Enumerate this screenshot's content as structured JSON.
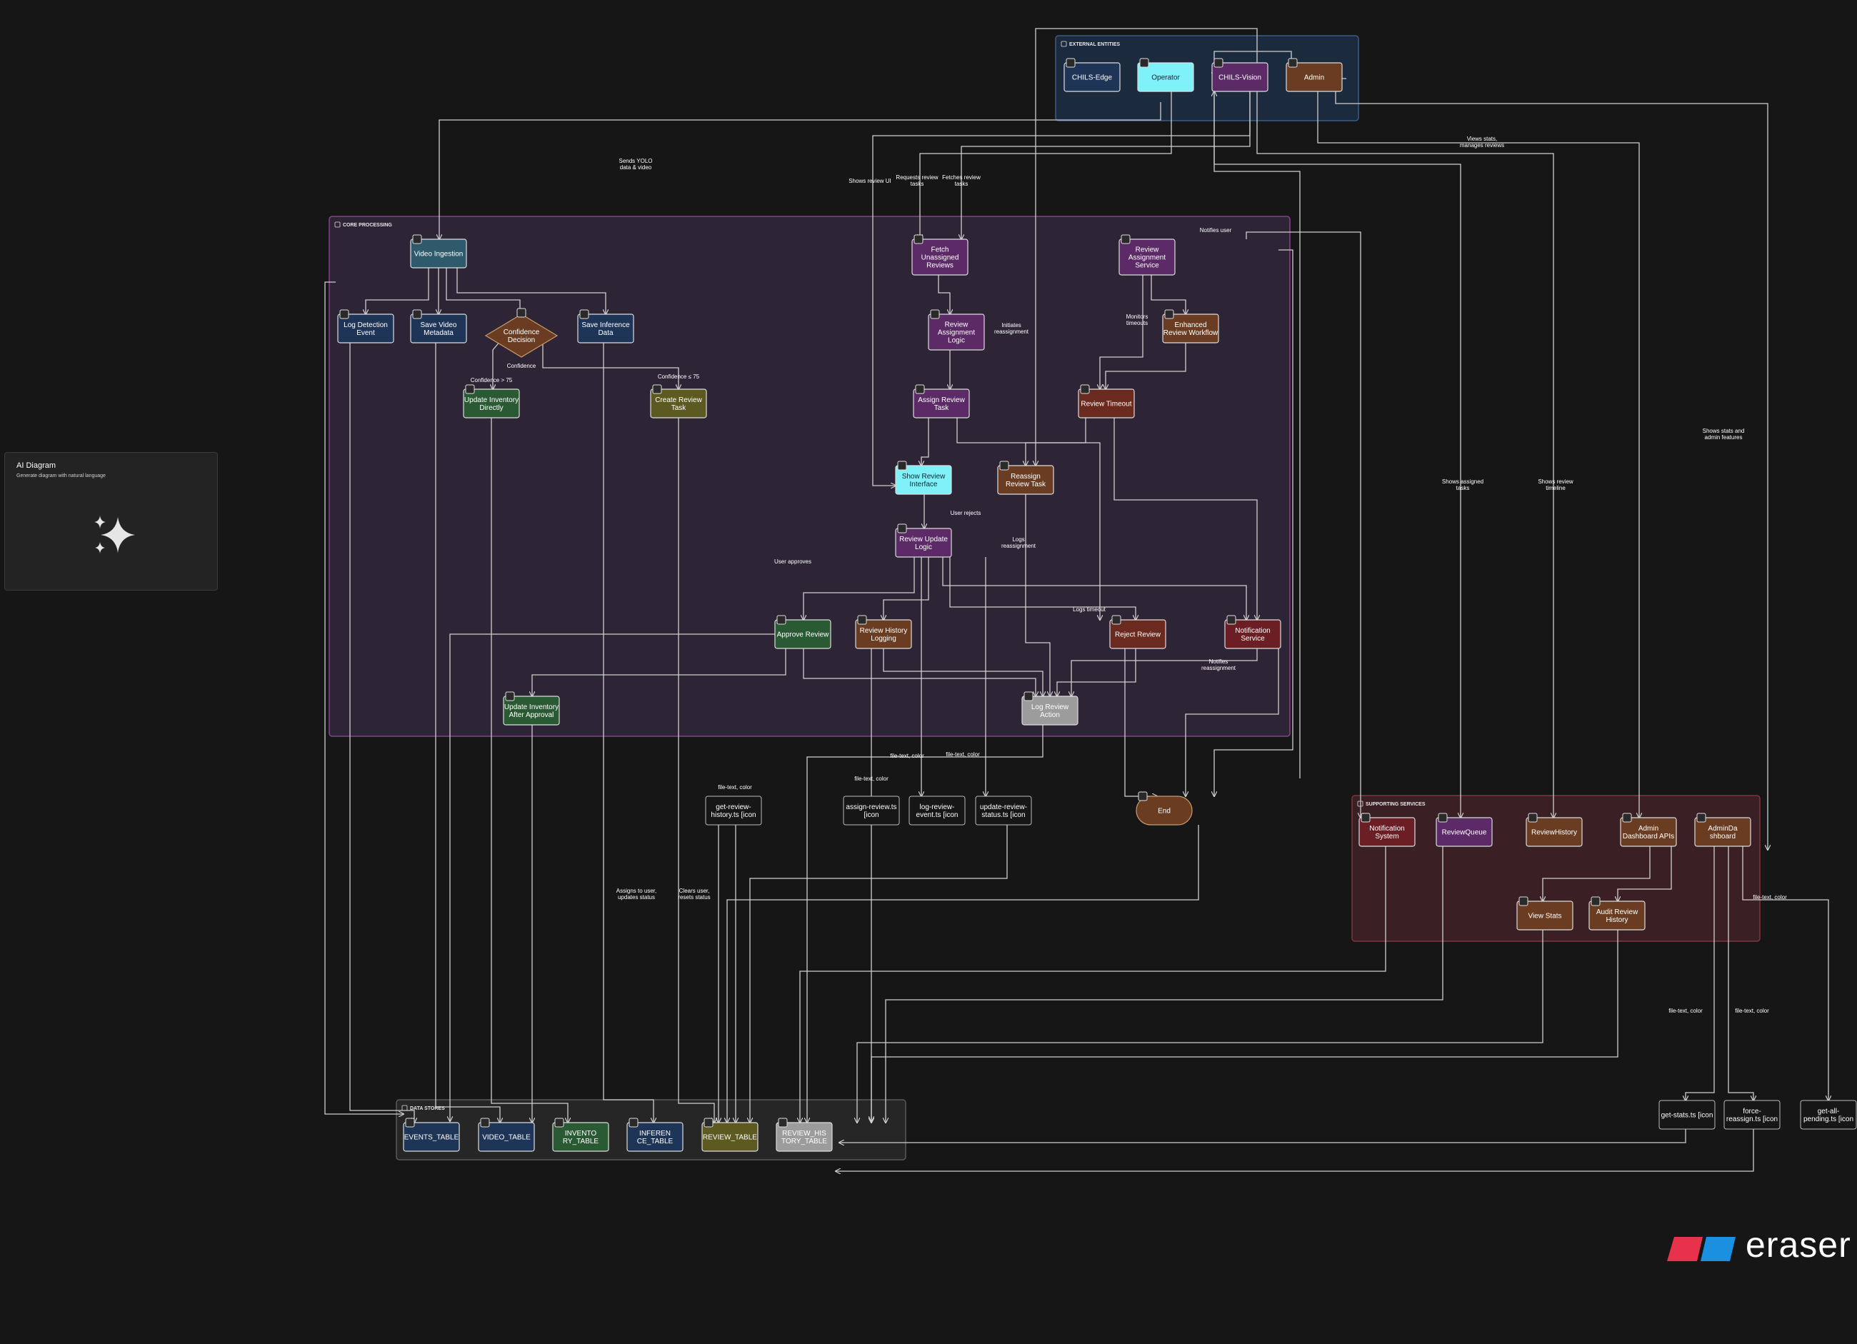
{
  "ai_panel": {
    "title": "AI Diagram",
    "subtitle": "Generate diagram with natural language"
  },
  "brand": {
    "name": "eraser"
  },
  "colors": {
    "background": "#161616",
    "edge": "#cfcfcf",
    "brand_red": "#e8314a",
    "brand_blue": "#1b8fe0"
  },
  "groups": [
    {
      "id": "external",
      "label": "EXTERNAL ENTITIES",
      "icon": "users-icon",
      "fill": "#1c2a3e",
      "stroke": "#3c5b86"
    },
    {
      "id": "core",
      "label": "CORE PROCESSING",
      "icon": "rocket-icon",
      "fill": "#2d2435",
      "stroke": "#8a3f8f"
    },
    {
      "id": "supporting",
      "label": "SUPPORTING SERVICES",
      "icon": "gear-icon",
      "fill": "#3a1f24",
      "stroke": "#7d3541"
    },
    {
      "id": "datastores",
      "label": "DATA STORES",
      "icon": "database-icon",
      "fill": "#262626",
      "stroke": "#585858"
    }
  ],
  "nodes": [
    {
      "id": "chils_edge",
      "label": [
        "CHILS-Edge"
      ],
      "icon": "camera-icon",
      "fill": "#1f3557",
      "text": "#ffffff"
    },
    {
      "id": "operator",
      "label": [
        "Operator"
      ],
      "icon": "user-icon",
      "fill": "#7ef2f8",
      "text": "#123"
    },
    {
      "id": "chils_vision",
      "label": [
        "CHILS-Vision"
      ],
      "icon": "eye-icon",
      "fill": "#5b2a67",
      "text": "#ffffff"
    },
    {
      "id": "admin",
      "label": [
        "Admin"
      ],
      "icon": "shield-icon",
      "fill": "#6a3d22",
      "text": "#ffffff"
    },
    {
      "id": "video_ingestion",
      "label": [
        "Video Ingestion"
      ],
      "icon": "video-icon",
      "fill": "#2f5a6b",
      "text": "#ffffff"
    },
    {
      "id": "log_detection",
      "label": [
        "Log Detection",
        "Event"
      ],
      "icon": "activity-icon",
      "fill": "#1f3557",
      "text": "#ffffff"
    },
    {
      "id": "save_video_meta",
      "label": [
        "Save Video",
        "Metadata"
      ],
      "icon": "film-icon",
      "fill": "#1f3557",
      "text": "#ffffff"
    },
    {
      "id": "confidence",
      "label": [
        "Confidence",
        "Decision"
      ],
      "icon": "gauge-icon",
      "fill": "#6a3d22",
      "text": "#ffffff"
    },
    {
      "id": "save_inference",
      "label": [
        "Save Inference",
        "Data"
      ],
      "icon": "cpu-icon",
      "fill": "#1f3557",
      "text": "#ffffff"
    },
    {
      "id": "update_inv_direct",
      "label": [
        "Update Inventory",
        "Directly"
      ],
      "icon": "box-icon",
      "fill": "#2a5a33",
      "text": "#ffffff"
    },
    {
      "id": "create_review",
      "label": [
        "Create Review",
        "Task"
      ],
      "icon": "plus-icon",
      "fill": "#5c5a20",
      "text": "#ffffff"
    },
    {
      "id": "fetch_unassigned",
      "label": [
        "Fetch",
        "Unassigned",
        "Reviews"
      ],
      "icon": "search-icon",
      "fill": "#5b2a67",
      "text": "#ffffff"
    },
    {
      "id": "review_assign_service",
      "label": [
        "Review",
        "Assignment",
        "Service"
      ],
      "icon": "users-icon",
      "fill": "#5b2a67",
      "text": "#ffffff"
    },
    {
      "id": "review_assign_logic",
      "label": [
        "Review",
        "Assignment",
        "Logic"
      ],
      "icon": "code-icon",
      "fill": "#5b2a67",
      "text": "#ffffff"
    },
    {
      "id": "enhanced_workflow",
      "label": [
        "Enhanced",
        "Review Workflow"
      ],
      "icon": "refresh-icon",
      "fill": "#6a3d22",
      "text": "#ffffff"
    },
    {
      "id": "assign_review_task",
      "label": [
        "Assign Review",
        "Task"
      ],
      "icon": "user-check-icon",
      "fill": "#5b2a67",
      "text": "#ffffff"
    },
    {
      "id": "review_timeout",
      "label": [
        "Review Timeout"
      ],
      "icon": "clock-icon",
      "fill": "#6b2a1f",
      "text": "#ffffff"
    },
    {
      "id": "show_review_ui",
      "label": [
        "Show Review",
        "Interface"
      ],
      "icon": "monitor-icon",
      "fill": "#7ef2f8",
      "text": "#123"
    },
    {
      "id": "reassign_task",
      "label": [
        "Reassign",
        "Review Task"
      ],
      "icon": "repeat-icon",
      "fill": "#6a3d22",
      "text": "#ffffff"
    },
    {
      "id": "review_update",
      "label": [
        "Review Update",
        "Logic"
      ],
      "icon": "edit-icon",
      "fill": "#5b2a67",
      "text": "#ffffff"
    },
    {
      "id": "approve_review",
      "label": [
        "Approve Review"
      ],
      "icon": "check-icon",
      "fill": "#2a5a33",
      "text": "#ffffff"
    },
    {
      "id": "history_logging",
      "label": [
        "Review History",
        "Logging"
      ],
      "icon": "file-icon",
      "fill": "#6a3d22",
      "text": "#ffffff"
    },
    {
      "id": "reject_review",
      "label": [
        "Reject Review"
      ],
      "icon": "x-icon",
      "fill": "#6b2a1f",
      "text": "#ffffff"
    },
    {
      "id": "notification_service",
      "label": [
        "Notification",
        "Service"
      ],
      "icon": "bell-icon",
      "fill": "#6b1f25",
      "text": "#ffffff"
    },
    {
      "id": "update_inv_approval",
      "label": [
        "Update Inventory",
        "After Approval"
      ],
      "icon": "box-icon",
      "fill": "#2a5a33",
      "text": "#ffffff"
    },
    {
      "id": "log_review_action",
      "label": [
        "Log Review",
        "Action"
      ],
      "icon": "log-icon",
      "fill": "#9c9c9c",
      "text": "#ffffff"
    },
    {
      "id": "get_review_history",
      "label": [
        "get-review-",
        "history.ts [icon"
      ],
      "icon": "",
      "fill": "#161616",
      "text": "#ffffff"
    },
    {
      "id": "assign_review_ts",
      "label": [
        "assign-review.ts",
        "[icon"
      ],
      "icon": "",
      "fill": "#161616",
      "text": "#ffffff"
    },
    {
      "id": "log_review_event_ts",
      "label": [
        "log-review-",
        "event.ts [icon"
      ],
      "icon": "",
      "fill": "#161616",
      "text": "#ffffff"
    },
    {
      "id": "update_review_status_ts",
      "label": [
        "update-review-",
        "status.ts [icon"
      ],
      "icon": "",
      "fill": "#161616",
      "text": "#ffffff"
    },
    {
      "id": "end",
      "label": [
        "End"
      ],
      "icon": "stop-icon",
      "fill": "#6a3d22",
      "text": "#ffffff"
    },
    {
      "id": "notification_system",
      "label": [
        "Notification",
        "System"
      ],
      "icon": "bell-icon",
      "fill": "#6b1f25",
      "text": "#ffffff"
    },
    {
      "id": "review_queue",
      "label": [
        "ReviewQueue"
      ],
      "icon": "list-icon",
      "fill": "#5b2a67",
      "text": "#ffffff"
    },
    {
      "id": "review_history_svc",
      "label": [
        "ReviewHistory"
      ],
      "icon": "clock-icon",
      "fill": "#6a3d22",
      "text": "#ffffff"
    },
    {
      "id": "admin_dashboard_apis",
      "label": [
        "Admin",
        "Dashboard APIs"
      ],
      "icon": "chart-icon",
      "fill": "#6a3d22",
      "text": "#ffffff"
    },
    {
      "id": "admin_dashboard",
      "label": [
        "AdminDa",
        "shboard"
      ],
      "icon": "dashboard-icon",
      "fill": "#6a3d22",
      "text": "#ffffff"
    },
    {
      "id": "view_stats",
      "label": [
        "View Stats"
      ],
      "icon": "bar-chart-icon",
      "fill": "#6a3d22",
      "text": "#ffffff"
    },
    {
      "id": "audit_history",
      "label": [
        "Audit Review",
        "History"
      ],
      "icon": "history-icon",
      "fill": "#6a3d22",
      "text": "#ffffff"
    },
    {
      "id": "get_stats_ts",
      "label": [
        "get-stats.ts [icon"
      ],
      "icon": "",
      "fill": "#161616",
      "text": "#ffffff"
    },
    {
      "id": "force_reassign_ts",
      "label": [
        "force-",
        "reassign.ts [icon"
      ],
      "icon": "",
      "fill": "#161616",
      "text": "#ffffff"
    },
    {
      "id": "get_all_pending_ts",
      "label": [
        "get-all-",
        "pending.ts [icon"
      ],
      "icon": "",
      "fill": "#161616",
      "text": "#ffffff"
    },
    {
      "id": "events_table",
      "label": [
        "EVENTS_TABLE"
      ],
      "icon": "table-icon",
      "fill": "#1f3557",
      "text": "#ffffff"
    },
    {
      "id": "video_table",
      "label": [
        "VIDEO_TABLE"
      ],
      "icon": "table-icon",
      "fill": "#1f3557",
      "text": "#ffffff"
    },
    {
      "id": "inventory_table",
      "label": [
        "INVENTO",
        "RY_TABLE"
      ],
      "icon": "table-icon",
      "fill": "#2a5a33",
      "text": "#ffffff"
    },
    {
      "id": "inference_table",
      "label": [
        "INFEREN",
        "CE_TABLE"
      ],
      "icon": "table-icon",
      "fill": "#1f3557",
      "text": "#ffffff"
    },
    {
      "id": "review_table",
      "label": [
        "REVIEW_TABLE"
      ],
      "icon": "table-icon",
      "fill": "#5c5a20",
      "text": "#ffffff"
    },
    {
      "id": "review_history_table",
      "label": [
        "REVIEW_HIS",
        "TORY_TABLE"
      ],
      "icon": "table-icon",
      "fill": "#9c9c9c",
      "text": "#ffffff"
    }
  ],
  "edge_labels": [
    {
      "id": "sends_yolo",
      "lines": [
        "Sends YOLO",
        "data & video"
      ]
    },
    {
      "id": "shows_review_ui",
      "lines": [
        "Shows review UI"
      ]
    },
    {
      "id": "requests_review",
      "lines": [
        "Requests review",
        "tasks"
      ]
    },
    {
      "id": "fetches_review",
      "lines": [
        "Fetches review",
        "tasks"
      ]
    },
    {
      "id": "notifies_user",
      "lines": [
        "Notifies user"
      ]
    },
    {
      "id": "views_stats",
      "lines": [
        "Views stats,",
        "manages reviews"
      ]
    },
    {
      "id": "initiates_reassignment",
      "lines": [
        "Initiates",
        "reassignment"
      ]
    },
    {
      "id": "monitors_timeouts",
      "lines": [
        "Monitors",
        "timeouts"
      ]
    },
    {
      "id": "confidence",
      "lines": [
        "Confidence"
      ]
    },
    {
      "id": "confidence_gt",
      "lines": [
        "Confidence > 75"
      ]
    },
    {
      "id": "confidence_lt",
      "lines": [
        "Confidence ≤ 75"
      ]
    },
    {
      "id": "user_rejects",
      "lines": [
        "User rejects"
      ]
    },
    {
      "id": "logs_reassignment",
      "lines": [
        "Logs",
        "reassignment"
      ]
    },
    {
      "id": "user_approves",
      "lines": [
        "User approves"
      ]
    },
    {
      "id": "logs_timeout",
      "lines": [
        "Logs timeout"
      ]
    },
    {
      "id": "notifies_reassignment",
      "lines": [
        "Notifies",
        "reassignment"
      ]
    },
    {
      "id": "shows_assigned",
      "lines": [
        "Shows assigned",
        "tasks"
      ]
    },
    {
      "id": "shows_timeline",
      "lines": [
        "Shows review",
        "timeline"
      ]
    },
    {
      "id": "shows_stats_admin",
      "lines": [
        "Shows stats and",
        "admin features"
      ]
    },
    {
      "id": "file_text_1",
      "lines": [
        "file-text, color"
      ]
    },
    {
      "id": "file_text_2",
      "lines": [
        "file-text, color"
      ]
    },
    {
      "id": "file_text_3",
      "lines": [
        "file-text, color"
      ]
    },
    {
      "id": "file_text_4",
      "lines": [
        "file-text, color"
      ]
    },
    {
      "id": "file_text_5",
      "lines": [
        "file-text, color"
      ]
    },
    {
      "id": "file_text_6",
      "lines": [
        "file-text, color"
      ]
    },
    {
      "id": "file_text_7",
      "lines": [
        "file-text, color"
      ]
    },
    {
      "id": "assigns_user",
      "lines": [
        "Assigns to user,",
        "updates status"
      ]
    },
    {
      "id": "clears_user",
      "lines": [
        "Clears user,",
        "resets status"
      ]
    }
  ]
}
